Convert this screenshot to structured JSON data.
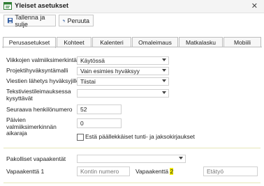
{
  "window": {
    "title": "Yleiset asetukset"
  },
  "toolbar": {
    "save_label": "Tallenna ja sulje",
    "cancel_label": "Peruuta"
  },
  "tabs": [
    {
      "label": "Perusasetukset",
      "active": true
    },
    {
      "label": "Kohteet"
    },
    {
      "label": "Kalenteri"
    },
    {
      "label": "Omaleimaus"
    },
    {
      "label": "Matkalasku"
    },
    {
      "label": "Mobiili"
    }
  ],
  "form": {
    "weekly": {
      "label": "Viikkojen valmiiksimerkintä",
      "value": "Käytössä"
    },
    "project": {
      "label": "Projektihyväksyntämalli",
      "value": "Vain esimies hyväksyy"
    },
    "send_day": {
      "label": "Viestien lähetys hyväksyjille",
      "value": "Tiistai"
    },
    "text_sign": {
      "label": "Tekstiviestileimauksessa kysyttävät",
      "value": ""
    },
    "next_person": {
      "label": "Seuraava henkilönumero",
      "value": "52"
    },
    "days_time": {
      "label": "Päivien valmiiksimerkinnän aikaraja",
      "value": "0"
    },
    "overlap": {
      "label": "Estä päällekkäiset tunti- ja jaksokirjaukset",
      "checked": false
    },
    "required": {
      "label": "Pakolliset vapaakentät",
      "value": ""
    },
    "field1": {
      "label": "Vapaakenttä 1",
      "value": "Kontin numero"
    },
    "field2": {
      "label_prefix": "Vapaakenttä ",
      "label_hl": "2",
      "placeholder": "Etätyö"
    }
  }
}
